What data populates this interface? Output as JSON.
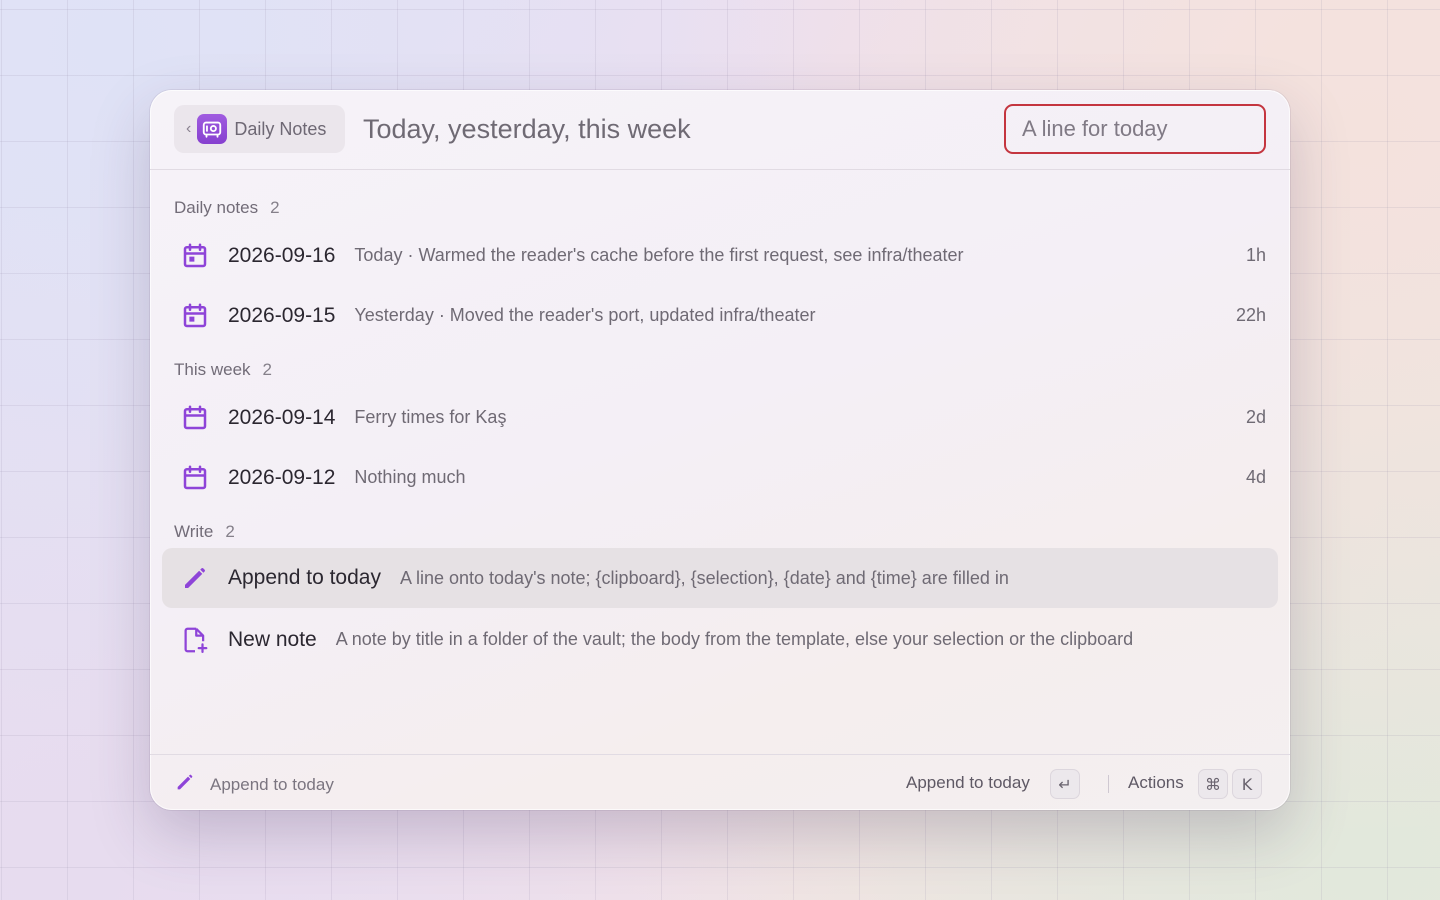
{
  "colors": {
    "accent": "#8e44d8",
    "search_border": "#c4353f"
  },
  "header": {
    "back_icon": "chevron-left-icon",
    "extension_icon": "safe-icon",
    "extension_name": "Daily Notes",
    "title": "Today, yesterday, this week",
    "search_placeholder": "A line for today"
  },
  "sections": [
    {
      "label": "Daily notes",
      "count": "2",
      "items": [
        {
          "icon": "calendar-icon",
          "title": "2026-09-16",
          "subtitle": "Today · Warmed the reader's cache before the first request, see infra/theater",
          "accessory": "1h"
        },
        {
          "icon": "calendar-icon",
          "title": "2026-09-15",
          "subtitle": "Yesterday · Moved the reader's port, updated infra/theater",
          "accessory": "22h"
        }
      ]
    },
    {
      "label": "This week",
      "count": "2",
      "items": [
        {
          "icon": "calendar-icon",
          "title": "2026-09-14",
          "subtitle": "Ferry times for Kaş",
          "accessory": "2d"
        },
        {
          "icon": "calendar-icon",
          "title": "2026-09-12",
          "subtitle": "Nothing much",
          "accessory": "4d"
        }
      ]
    },
    {
      "label": "Write",
      "count": "2",
      "items": [
        {
          "icon": "pencil-icon",
          "title": "Append to today",
          "subtitle": "A line onto today's note; {clipboard}, {selection}, {date} and {time} are filled in",
          "accessory": "",
          "selected": true
        },
        {
          "icon": "new-document-icon",
          "title": "New note",
          "subtitle": "A note by title in a folder of the vault; the body from the template, else your selection or the clipboard",
          "accessory": ""
        }
      ]
    }
  ],
  "footer": {
    "nav_icon": "pencil-icon",
    "nav_label": "Append to today",
    "primary_action": "Append to today",
    "primary_key": "↵",
    "actions_label": "Actions",
    "actions_keys": [
      "⌘",
      "K"
    ]
  }
}
